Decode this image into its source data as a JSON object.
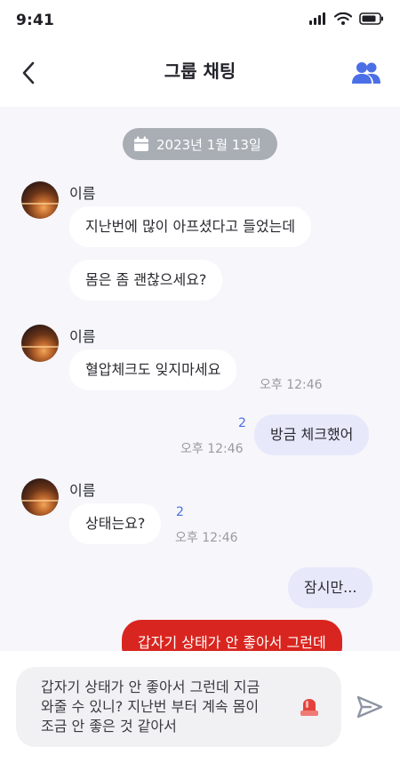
{
  "status_bar": {
    "time": "9:41"
  },
  "header": {
    "title": "그룹 채팅"
  },
  "chat": {
    "date": "2023년 1월 13일",
    "messages": [
      {
        "sender": "이름",
        "bubbles": [
          "지난번에 많이 아프셨다고 들었는데",
          "몸은 좀 괜찮으세요?"
        ]
      },
      {
        "sender": "이름",
        "text": "혈압체크도 잊지마세요",
        "time": "오후 12:46"
      },
      {
        "text": "방금 체크했어",
        "unread": "2",
        "time": "오후 12:46"
      },
      {
        "sender": "이름",
        "text": "상태는요?",
        "unread": "2",
        "time": "오후 12:46"
      },
      {
        "text": "잠시만..."
      },
      {
        "text": "갑자기 상태가 안 좋아서 그런데"
      }
    ]
  },
  "composer": {
    "value": "갑자기 상태가 안 좋아서 그런데 지금 와줄 수 있니? 지난번 부터 계속 몸이 조금 안 좋은 것 같아서"
  },
  "colors": {
    "accent": "#4B6FE6",
    "my_bubble": "#E7E9FB",
    "emergency": "#D9251F",
    "date_pill": "#A9AEB5"
  },
  "icons": [
    "back-icon",
    "group-icon",
    "calendar-icon",
    "siren-icon",
    "send-icon",
    "signal-icon",
    "wifi-icon",
    "battery-icon"
  ]
}
